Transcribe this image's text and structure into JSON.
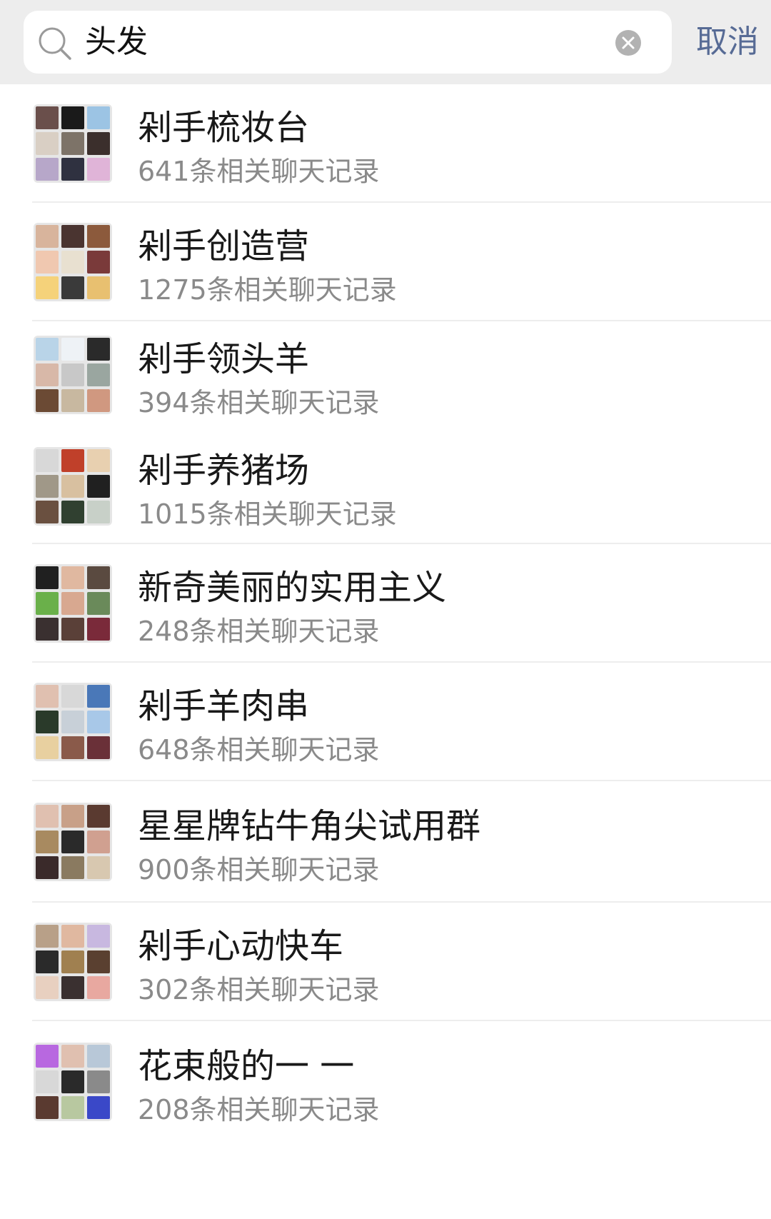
{
  "search": {
    "query": "头发",
    "cancel_label": "取消"
  },
  "results": [
    {
      "title": "剁手梳妆台",
      "subtitle": "641条相关聊天记录"
    },
    {
      "title": "剁手创造营",
      "subtitle": "1275条相关聊天记录"
    },
    {
      "title": "剁手领头羊",
      "subtitle": "394条相关聊天记录"
    },
    {
      "title": "剁手养猪场",
      "subtitle": "1015条相关聊天记录"
    },
    {
      "title": "新奇美丽的实用主义",
      "subtitle": "248条相关聊天记录"
    },
    {
      "title": "剁手羊肉串",
      "subtitle": "648条相关聊天记录"
    },
    {
      "title": "星星牌钻牛角尖试用群",
      "subtitle": "900条相关聊天记录"
    },
    {
      "title": "剁手心动快车",
      "subtitle": "302条相关聊天记录"
    },
    {
      "title": "花束般的一 一",
      "subtitle": "208条相关聊天记录"
    }
  ],
  "colors": {
    "header_bg": "#ededed",
    "accent": "#576b95",
    "secondary_text": "#8a8a8a"
  }
}
